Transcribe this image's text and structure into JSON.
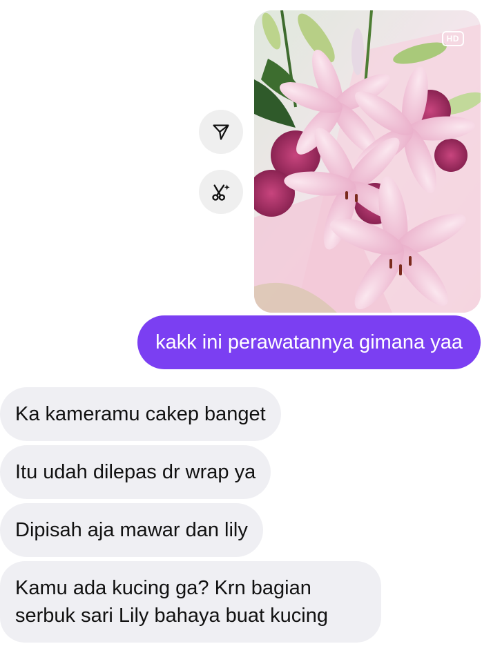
{
  "image_message": {
    "hd_label": "HD"
  },
  "actions": {
    "share_icon": "send-paper-plane-icon",
    "ai_edit_icon": "scissors-sparkle-icon"
  },
  "sent_messages": [
    {
      "text": "kakk ini perawatannya gimana yaa"
    }
  ],
  "received_messages": [
    {
      "text": "Ka kameramu cakep banget"
    },
    {
      "text": "Itu udah dilepas dr wrap ya"
    },
    {
      "text": "Dipisah aja mawar dan lily"
    },
    {
      "lines": [
        "Kamu ada kucing ga? Krn bagian",
        "serbuk sari Lily bahaya buat kucing"
      ]
    }
  ],
  "colors": {
    "sent_bubble": "#7b3ff2",
    "received_bubble": "#efeff3",
    "action_button": "#efefef"
  }
}
